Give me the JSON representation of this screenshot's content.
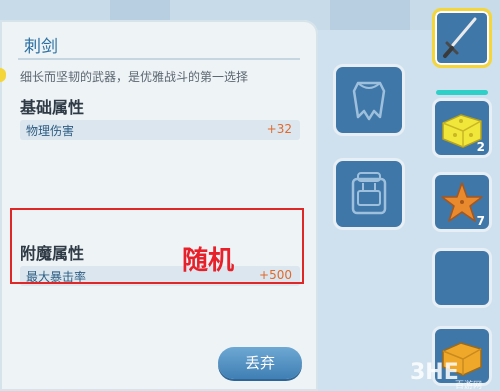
{
  "panel": {
    "title": "刺剑",
    "description": "细长而坚韧的武器，是优雅战斗的第一选择",
    "base_section": {
      "title": "基础属性",
      "stats": [
        {
          "name": "物理伤害",
          "value": "+32"
        }
      ]
    },
    "enchant_section": {
      "title": "附魔属性",
      "stats": [
        {
          "name": "最大暴击率",
          "value": "+500"
        }
      ]
    },
    "annotation": "随机",
    "discard_label": "丢弃"
  },
  "equipment_slots": [
    {
      "icon": "cape-icon"
    },
    {
      "icon": "backpack-icon"
    }
  ],
  "inventory": [
    {
      "icon": "rapier-icon",
      "count": "",
      "selected": true
    },
    {
      "icon": "sponge-icon",
      "count": "2"
    },
    {
      "icon": "starfish-icon",
      "count": "7"
    },
    {
      "icon": "empty-slot",
      "count": ""
    },
    {
      "icon": "sponge-icon",
      "count": ""
    }
  ],
  "watermark": {
    "text": "3HE",
    "sub": "百游网"
  },
  "colors": {
    "accent": "#2a6fa1",
    "value_orange": "#e06a2e",
    "highlight_red": "#e02727",
    "selected_yellow": "#f4d63b",
    "slot_blue": "#3f77a9"
  }
}
